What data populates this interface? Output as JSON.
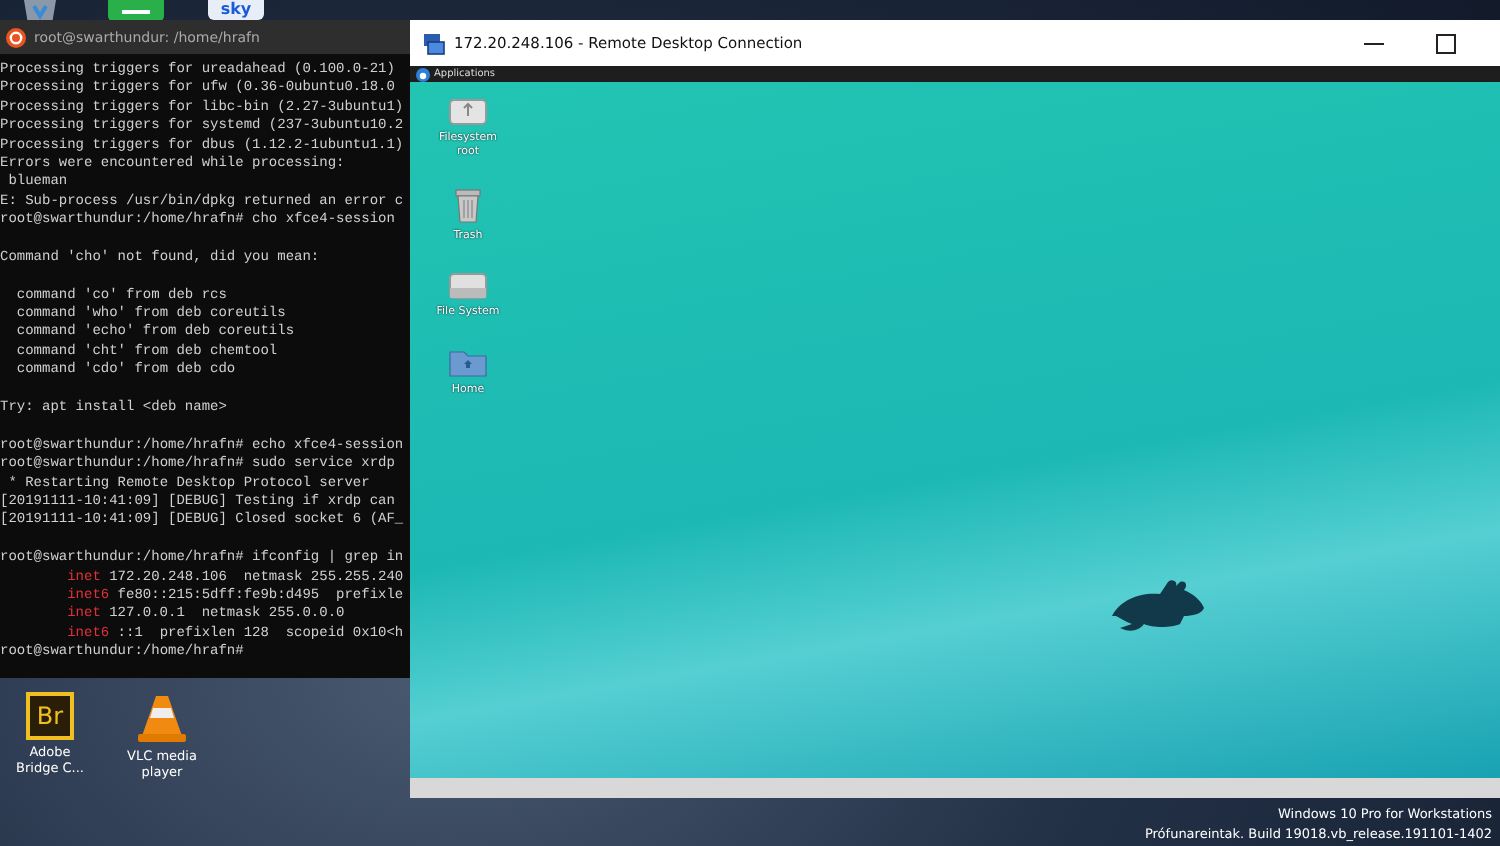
{
  "top_icons": [
    {
      "kind": "recycle"
    },
    {
      "kind": "green"
    },
    {
      "kind": "sky",
      "label": "sky"
    }
  ],
  "terminal": {
    "title": "root@swarthundur: /home/hrafn",
    "lines": [
      {
        "kind": "plain",
        "text": "Processing triggers for ureadahead (0.100.0-21)"
      },
      {
        "kind": "plain",
        "text": "Processing triggers for ufw (0.36-0ubuntu0.18.0"
      },
      {
        "kind": "plain",
        "text": "Processing triggers for libc-bin (2.27-3ubuntu1)"
      },
      {
        "kind": "plain",
        "text": "Processing triggers for systemd (237-3ubuntu10.2"
      },
      {
        "kind": "plain",
        "text": "Processing triggers for dbus (1.12.2-1ubuntu1.1)"
      },
      {
        "kind": "plain",
        "text": "Errors were encountered while processing:"
      },
      {
        "kind": "plain",
        "text": " blueman"
      },
      {
        "kind": "plain",
        "text": "E: Sub-process /usr/bin/dpkg returned an error c"
      },
      {
        "kind": "plain",
        "text": "root@swarthundur:/home/hrafn# cho xfce4-session"
      },
      {
        "kind": "blank"
      },
      {
        "kind": "plain",
        "text": "Command 'cho' not found, did you mean:"
      },
      {
        "kind": "blank"
      },
      {
        "kind": "plain",
        "text": "  command 'co' from deb rcs"
      },
      {
        "kind": "plain",
        "text": "  command 'who' from deb coreutils"
      },
      {
        "kind": "plain",
        "text": "  command 'echo' from deb coreutils"
      },
      {
        "kind": "plain",
        "text": "  command 'cht' from deb chemtool"
      },
      {
        "kind": "plain",
        "text": "  command 'cdo' from deb cdo"
      },
      {
        "kind": "blank"
      },
      {
        "kind": "plain",
        "text": "Try: apt install <deb name>"
      },
      {
        "kind": "blank"
      },
      {
        "kind": "plain",
        "text": "root@swarthundur:/home/hrafn# echo xfce4-session"
      },
      {
        "kind": "plain",
        "text": "root@swarthundur:/home/hrafn# sudo service xrdp"
      },
      {
        "kind": "plain",
        "text": " * Restarting Remote Desktop Protocol server"
      },
      {
        "kind": "plain",
        "text": "[20191111-10:41:09] [DEBUG] Testing if xrdp can"
      },
      {
        "kind": "plain",
        "text": "[20191111-10:41:09] [DEBUG] Closed socket 6 (AF_"
      },
      {
        "kind": "blank"
      },
      {
        "kind": "plain",
        "text": "root@swarthundur:/home/hrafn# ifconfig | grep in"
      },
      {
        "kind": "match",
        "keyword": "inet",
        "text": " 172.20.248.106  netmask 255.255.240"
      },
      {
        "kind": "match",
        "keyword": "inet6",
        "text": " fe80::215:5dff:fe9b:d495  prefixle"
      },
      {
        "kind": "match",
        "keyword": "inet",
        "text": " 127.0.0.1  netmask 255.0.0.0"
      },
      {
        "kind": "match",
        "keyword": "inet6",
        "text": " ::1  prefixlen 128  scopeid 0x10<h"
      },
      {
        "kind": "plain",
        "text": "root@swarthundur:/home/hrafn#"
      }
    ]
  },
  "remote_desktop": {
    "title": "172.20.248.106 - Remote Desktop Connection",
    "panel_menu": "Applications",
    "icons": [
      {
        "kind": "drive",
        "label": "Filesystem root"
      },
      {
        "kind": "trash",
        "label": "Trash"
      },
      {
        "kind": "disk",
        "label": "File System"
      },
      {
        "kind": "folder",
        "label": "Home"
      }
    ]
  },
  "desktop_icons": [
    {
      "kind": "bridge",
      "badge": "Br",
      "label": "Adobe Bridge C..."
    },
    {
      "kind": "vlc",
      "label": "VLC media player"
    }
  ],
  "watermark": [
    "Windows 10 Pro for Workstations",
    "Prófunareintak. Build 19018.vb_release.191101-1402"
  ]
}
